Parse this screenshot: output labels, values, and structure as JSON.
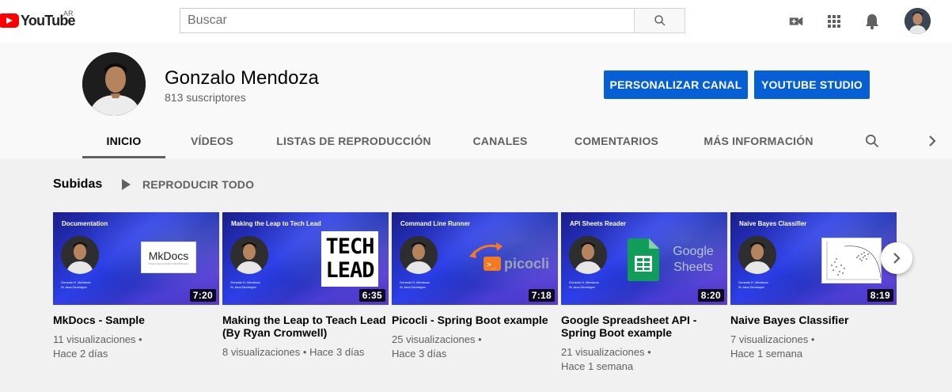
{
  "masthead": {
    "logo_text": "YouTube",
    "country_code": "AR",
    "search_placeholder": "Buscar",
    "icons": [
      "search-icon",
      "create-video-icon",
      "apps-grid-icon",
      "notifications-bell-icon",
      "account-avatar"
    ]
  },
  "channel": {
    "name": "Gonzalo Mendoza",
    "subscribers": "813 suscriptores",
    "customize_button": "PERSONALIZAR CANAL",
    "studio_button": "YOUTUBE STUDIO"
  },
  "tabs": [
    {
      "label": "INICIO",
      "active": true
    },
    {
      "label": "VÍDEOS",
      "active": false
    },
    {
      "label": "LISTAS DE REPRODUCCIÓN",
      "active": false
    },
    {
      "label": "CANALES",
      "active": false
    },
    {
      "label": "COMENTARIOS",
      "active": false
    },
    {
      "label": "MÁS INFORMACIÓN",
      "active": false
    }
  ],
  "uploads": {
    "title": "Subidas",
    "play_all": "REPRODUCIR TODO",
    "videos": [
      {
        "thumb_heading": "Documentation",
        "thumb_art": "MkDocs",
        "duration": "7:20",
        "title": "MkDocs - Sample",
        "views": "11 visualizaciones",
        "age": "Hace 2 días"
      },
      {
        "thumb_heading": "Making the Leap to Tech Lead",
        "thumb_art": "TECH LEAD",
        "duration": "6:35",
        "title": "Making the Leap to Teach Lead (By Ryan Cromwell)",
        "views": "8 visualizaciones",
        "age": "Hace 3 días"
      },
      {
        "thumb_heading": "Command Line Runner",
        "thumb_art": "picocli",
        "duration": "7:18",
        "title": "Picocli - Spring Boot example",
        "views": "25 visualizaciones",
        "age": "Hace 3 días"
      },
      {
        "thumb_heading": "API Sheets Reader",
        "thumb_art": "Google Sheets",
        "duration": "8:20",
        "title": "Google Spreadsheet API - Spring Boot example",
        "views": "21 visualizaciones",
        "age": "Hace 1 semana"
      },
      {
        "thumb_heading": "Naive Bayes Classifier",
        "thumb_art": "scatter-plot",
        "duration": "8:19",
        "title": "Naive Bayes Classifier",
        "views": "7 visualizaciones",
        "age": "Hace 1 semana"
      }
    ]
  },
  "colors": {
    "accent_blue": "#065fd4",
    "youtube_red": "#ff0000"
  }
}
